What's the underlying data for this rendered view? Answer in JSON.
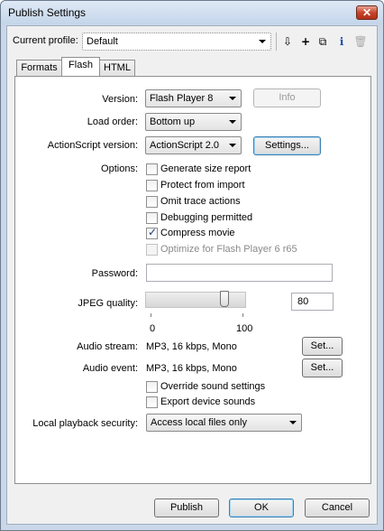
{
  "window": {
    "title": "Publish Settings",
    "close_glyph": "✕"
  },
  "profile": {
    "label": "Current profile:",
    "value": "Default",
    "tools": [
      {
        "name": "import-export-icon",
        "glyph": "⇩"
      },
      {
        "name": "add-profile-icon",
        "glyph": "+"
      },
      {
        "name": "duplicate-profile-icon",
        "glyph": "⧉"
      },
      {
        "name": "profile-info-icon",
        "glyph": "ℹ"
      },
      {
        "name": "delete-profile-icon",
        "glyph": "🗑"
      }
    ]
  },
  "tabs": [
    {
      "label": "Formats",
      "active": false
    },
    {
      "label": "Flash",
      "active": true
    },
    {
      "label": "HTML",
      "active": false
    }
  ],
  "flash": {
    "version": {
      "label": "Version:",
      "value": "Flash Player 8",
      "info_button": "Info"
    },
    "load_order": {
      "label": "Load order:",
      "value": "Bottom up"
    },
    "actionscript": {
      "label": "ActionScript version:",
      "value": "ActionScript 2.0",
      "settings_button": "Settings..."
    },
    "options": {
      "label": "Options:",
      "items": [
        {
          "label": "Generate size report",
          "checked": false,
          "disabled": false
        },
        {
          "label": "Protect from import",
          "checked": false,
          "disabled": false
        },
        {
          "label": "Omit trace actions",
          "checked": false,
          "disabled": false
        },
        {
          "label": "Debugging permitted",
          "checked": false,
          "disabled": false
        },
        {
          "label": "Compress movie",
          "checked": true,
          "disabled": false
        },
        {
          "label": "Optimize for Flash Player 6 r65",
          "checked": false,
          "disabled": true
        }
      ]
    },
    "password": {
      "label": "Password:",
      "value": ""
    },
    "jpeg": {
      "label": "JPEG quality:",
      "value": "80",
      "min_label": "0",
      "max_label": "100",
      "level": 80
    },
    "audio_stream": {
      "label": "Audio stream:",
      "value": "MP3, 16 kbps, Mono",
      "button": "Set..."
    },
    "audio_event": {
      "label": "Audio event:",
      "value": "MP3, 16 kbps, Mono",
      "button": "Set..."
    },
    "sound_options": [
      {
        "label": "Override sound settings",
        "checked": false
      },
      {
        "label": "Export device sounds",
        "checked": false
      }
    ],
    "playback_security": {
      "label": "Local playback security:",
      "value": "Access local files only"
    }
  },
  "footer": {
    "publish": "Publish",
    "ok": "OK",
    "cancel": "Cancel"
  },
  "colors": {
    "title_bar": "#c4d5ea",
    "close": "#c8432b",
    "ok_border": "#3c7fb1"
  }
}
